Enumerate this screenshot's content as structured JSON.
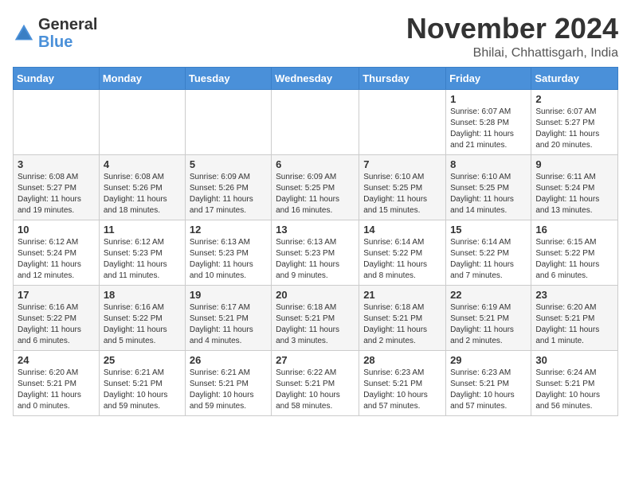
{
  "header": {
    "logo_general": "General",
    "logo_blue": "Blue",
    "month_title": "November 2024",
    "subtitle": "Bhilai, Chhattisgarh, India"
  },
  "weekdays": [
    "Sunday",
    "Monday",
    "Tuesday",
    "Wednesday",
    "Thursday",
    "Friday",
    "Saturday"
  ],
  "weeks": [
    [
      {
        "day": "",
        "info": ""
      },
      {
        "day": "",
        "info": ""
      },
      {
        "day": "",
        "info": ""
      },
      {
        "day": "",
        "info": ""
      },
      {
        "day": "",
        "info": ""
      },
      {
        "day": "1",
        "info": "Sunrise: 6:07 AM\nSunset: 5:28 PM\nDaylight: 11 hours and 21 minutes."
      },
      {
        "day": "2",
        "info": "Sunrise: 6:07 AM\nSunset: 5:27 PM\nDaylight: 11 hours and 20 minutes."
      }
    ],
    [
      {
        "day": "3",
        "info": "Sunrise: 6:08 AM\nSunset: 5:27 PM\nDaylight: 11 hours and 19 minutes."
      },
      {
        "day": "4",
        "info": "Sunrise: 6:08 AM\nSunset: 5:26 PM\nDaylight: 11 hours and 18 minutes."
      },
      {
        "day": "5",
        "info": "Sunrise: 6:09 AM\nSunset: 5:26 PM\nDaylight: 11 hours and 17 minutes."
      },
      {
        "day": "6",
        "info": "Sunrise: 6:09 AM\nSunset: 5:25 PM\nDaylight: 11 hours and 16 minutes."
      },
      {
        "day": "7",
        "info": "Sunrise: 6:10 AM\nSunset: 5:25 PM\nDaylight: 11 hours and 15 minutes."
      },
      {
        "day": "8",
        "info": "Sunrise: 6:10 AM\nSunset: 5:25 PM\nDaylight: 11 hours and 14 minutes."
      },
      {
        "day": "9",
        "info": "Sunrise: 6:11 AM\nSunset: 5:24 PM\nDaylight: 11 hours and 13 minutes."
      }
    ],
    [
      {
        "day": "10",
        "info": "Sunrise: 6:12 AM\nSunset: 5:24 PM\nDaylight: 11 hours and 12 minutes."
      },
      {
        "day": "11",
        "info": "Sunrise: 6:12 AM\nSunset: 5:23 PM\nDaylight: 11 hours and 11 minutes."
      },
      {
        "day": "12",
        "info": "Sunrise: 6:13 AM\nSunset: 5:23 PM\nDaylight: 11 hours and 10 minutes."
      },
      {
        "day": "13",
        "info": "Sunrise: 6:13 AM\nSunset: 5:23 PM\nDaylight: 11 hours and 9 minutes."
      },
      {
        "day": "14",
        "info": "Sunrise: 6:14 AM\nSunset: 5:22 PM\nDaylight: 11 hours and 8 minutes."
      },
      {
        "day": "15",
        "info": "Sunrise: 6:14 AM\nSunset: 5:22 PM\nDaylight: 11 hours and 7 minutes."
      },
      {
        "day": "16",
        "info": "Sunrise: 6:15 AM\nSunset: 5:22 PM\nDaylight: 11 hours and 6 minutes."
      }
    ],
    [
      {
        "day": "17",
        "info": "Sunrise: 6:16 AM\nSunset: 5:22 PM\nDaylight: 11 hours and 6 minutes."
      },
      {
        "day": "18",
        "info": "Sunrise: 6:16 AM\nSunset: 5:22 PM\nDaylight: 11 hours and 5 minutes."
      },
      {
        "day": "19",
        "info": "Sunrise: 6:17 AM\nSunset: 5:21 PM\nDaylight: 11 hours and 4 minutes."
      },
      {
        "day": "20",
        "info": "Sunrise: 6:18 AM\nSunset: 5:21 PM\nDaylight: 11 hours and 3 minutes."
      },
      {
        "day": "21",
        "info": "Sunrise: 6:18 AM\nSunset: 5:21 PM\nDaylight: 11 hours and 2 minutes."
      },
      {
        "day": "22",
        "info": "Sunrise: 6:19 AM\nSunset: 5:21 PM\nDaylight: 11 hours and 2 minutes."
      },
      {
        "day": "23",
        "info": "Sunrise: 6:20 AM\nSunset: 5:21 PM\nDaylight: 11 hours and 1 minute."
      }
    ],
    [
      {
        "day": "24",
        "info": "Sunrise: 6:20 AM\nSunset: 5:21 PM\nDaylight: 11 hours and 0 minutes."
      },
      {
        "day": "25",
        "info": "Sunrise: 6:21 AM\nSunset: 5:21 PM\nDaylight: 10 hours and 59 minutes."
      },
      {
        "day": "26",
        "info": "Sunrise: 6:21 AM\nSunset: 5:21 PM\nDaylight: 10 hours and 59 minutes."
      },
      {
        "day": "27",
        "info": "Sunrise: 6:22 AM\nSunset: 5:21 PM\nDaylight: 10 hours and 58 minutes."
      },
      {
        "day": "28",
        "info": "Sunrise: 6:23 AM\nSunset: 5:21 PM\nDaylight: 10 hours and 57 minutes."
      },
      {
        "day": "29",
        "info": "Sunrise: 6:23 AM\nSunset: 5:21 PM\nDaylight: 10 hours and 57 minutes."
      },
      {
        "day": "30",
        "info": "Sunrise: 6:24 AM\nSunset: 5:21 PM\nDaylight: 10 hours and 56 minutes."
      }
    ]
  ]
}
